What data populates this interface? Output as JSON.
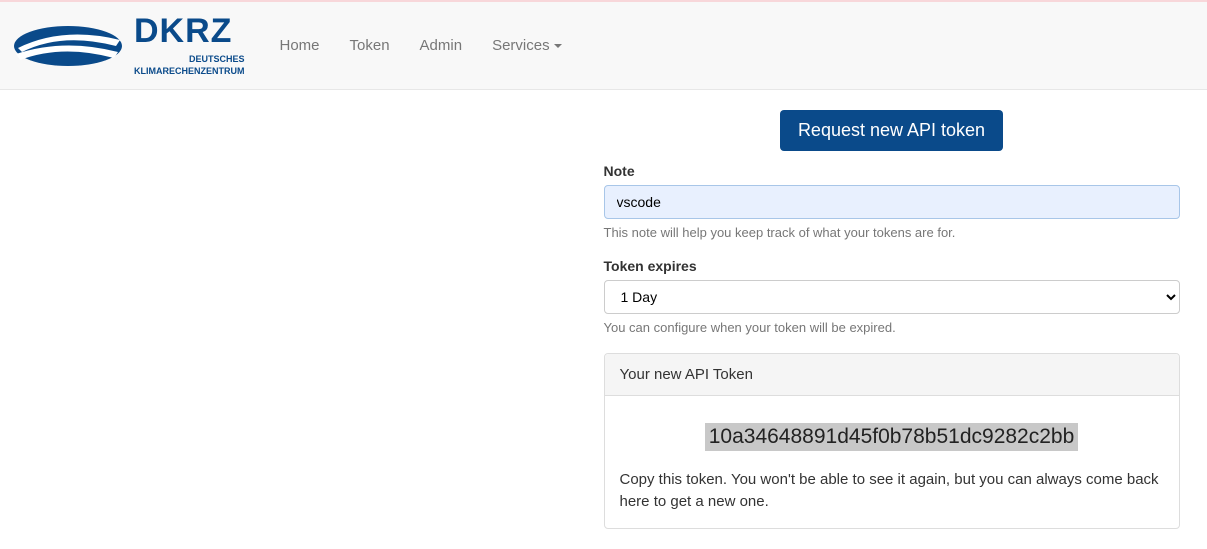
{
  "brand": {
    "name": "DKRZ",
    "subtitle_line1": "DEUTSCHES",
    "subtitle_line2": "KLIMARECHENZENTRUM"
  },
  "nav": {
    "home": "Home",
    "token": "Token",
    "admin": "Admin",
    "services": "Services"
  },
  "form": {
    "request_button": "Request new API token",
    "note_label": "Note",
    "note_value": "vscode",
    "note_help": "This note will help you keep track of what your tokens are for.",
    "expires_label": "Token expires",
    "expires_selected": "1 Day",
    "expires_help": "You can configure when your token will be expired."
  },
  "panel": {
    "heading": "Your new API Token",
    "token": "10a34648891d45f0b78b51dc9282c2bb",
    "instructions": "Copy this token. You won't be able to see it again, but you can always come back here to get a new one."
  }
}
